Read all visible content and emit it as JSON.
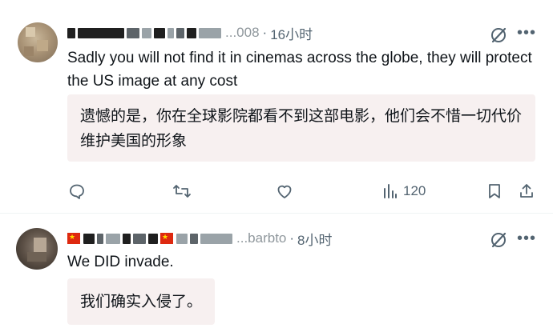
{
  "posts": [
    {
      "handle_tail": "...008",
      "time": "16小时",
      "text": "Sadly you will not find it in cinemas across the globe, they will protect the US image at any cost",
      "translation": "遗憾的是，你在全球影院都看不到这部电影，他们会不惜一切代价维护美国的形象",
      "views": "120"
    },
    {
      "handle_tail": "...barbto",
      "time": "8小时",
      "text": "We DID invade.",
      "translation": "我们确实入侵了。"
    }
  ],
  "meta_separator": "·",
  "icons": [
    "grok-icon",
    "more-icon",
    "reply-icon",
    "repost-icon",
    "like-icon",
    "views-icon",
    "bookmark-icon",
    "share-icon"
  ],
  "colors": {
    "text": "#0f1419",
    "secondary": "#536471",
    "translation_bg": "#f7f0f0"
  }
}
